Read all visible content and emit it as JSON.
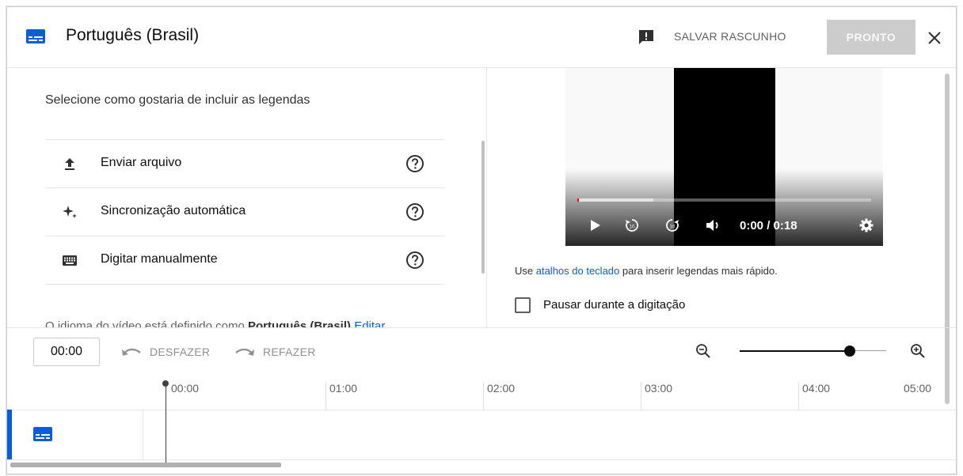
{
  "header": {
    "title": "Português (Brasil)",
    "save_draft_label": "SALVAR RASCUNHO",
    "done_label": "PRONTO"
  },
  "left": {
    "heading": "Selecione como gostaria de incluir as legendas",
    "options": [
      {
        "label": "Enviar arquivo",
        "icon": "upload-icon"
      },
      {
        "label": "Sincronização automática",
        "icon": "sparkle-icon"
      },
      {
        "label": "Digitar manualmente",
        "icon": "keyboard-icon"
      }
    ],
    "clipped_prefix": "O idioma do vídeo está definido como ",
    "clipped_bold": "Português (Brasil)",
    "clipped_link": "Editar"
  },
  "player": {
    "time": "0:00 / 0:18",
    "played_fraction": 0.004,
    "buffered_fraction": 0.26
  },
  "right": {
    "hint_prefix": "Use ",
    "hint_link": "atalhos do teclado",
    "hint_suffix": " para inserir legendas mais rápido.",
    "pause_label": "Pausar durante a digitação",
    "pause_checked": false
  },
  "toolbar": {
    "time_value": "00:00",
    "undo_label": "DESFAZER",
    "redo_label": "REFAZER",
    "zoom_fraction": 0.75
  },
  "timeline": {
    "ticks": [
      "00:00",
      "01:00",
      "02:00",
      "03:00",
      "04:00",
      "05:00"
    ]
  },
  "colors": {
    "accent": "#065fd4",
    "progress_red": "#ff0000",
    "disabled_button": "#cccccc"
  }
}
